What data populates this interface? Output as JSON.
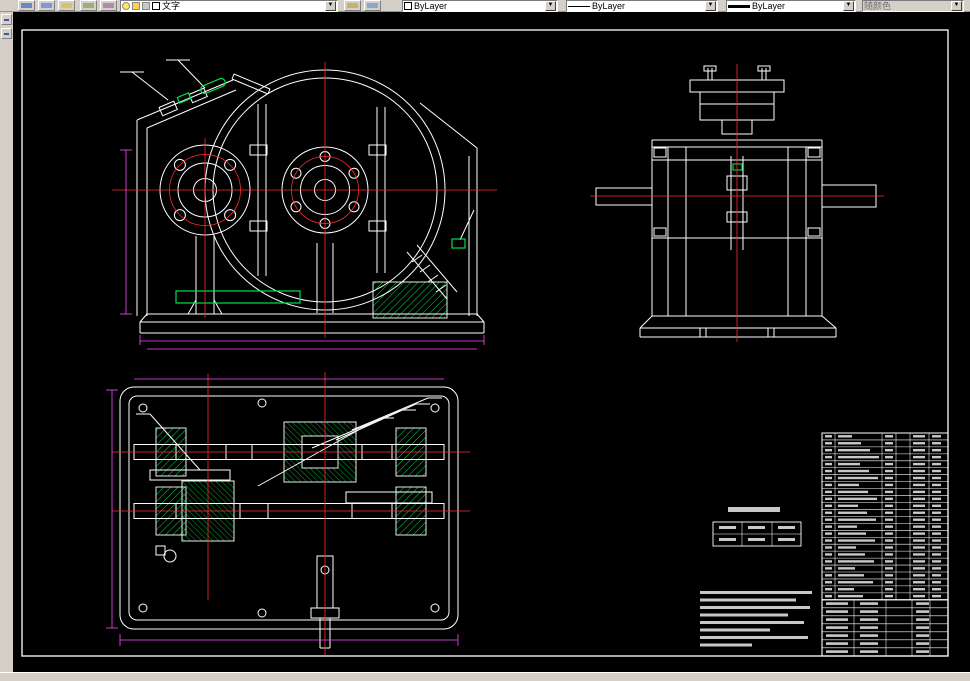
{
  "toolbar": {
    "layer_combo": {
      "value": "文字"
    },
    "color_combo": {
      "value": "ByLayer"
    },
    "linetype_combo": {
      "value": "ByLayer"
    },
    "lineweight_combo": {
      "value": "ByLayer"
    },
    "plot_style_combo": {
      "value": "随颜色"
    },
    "arrow_glyph": "▼"
  },
  "palette": {
    "background": "#000000",
    "line": "#ffffff",
    "centerline": "#ff2a2a",
    "detail_green": "#00e050",
    "dimension_magenta": "#ff4dff"
  },
  "parts_list": {
    "row_count": 24
  }
}
